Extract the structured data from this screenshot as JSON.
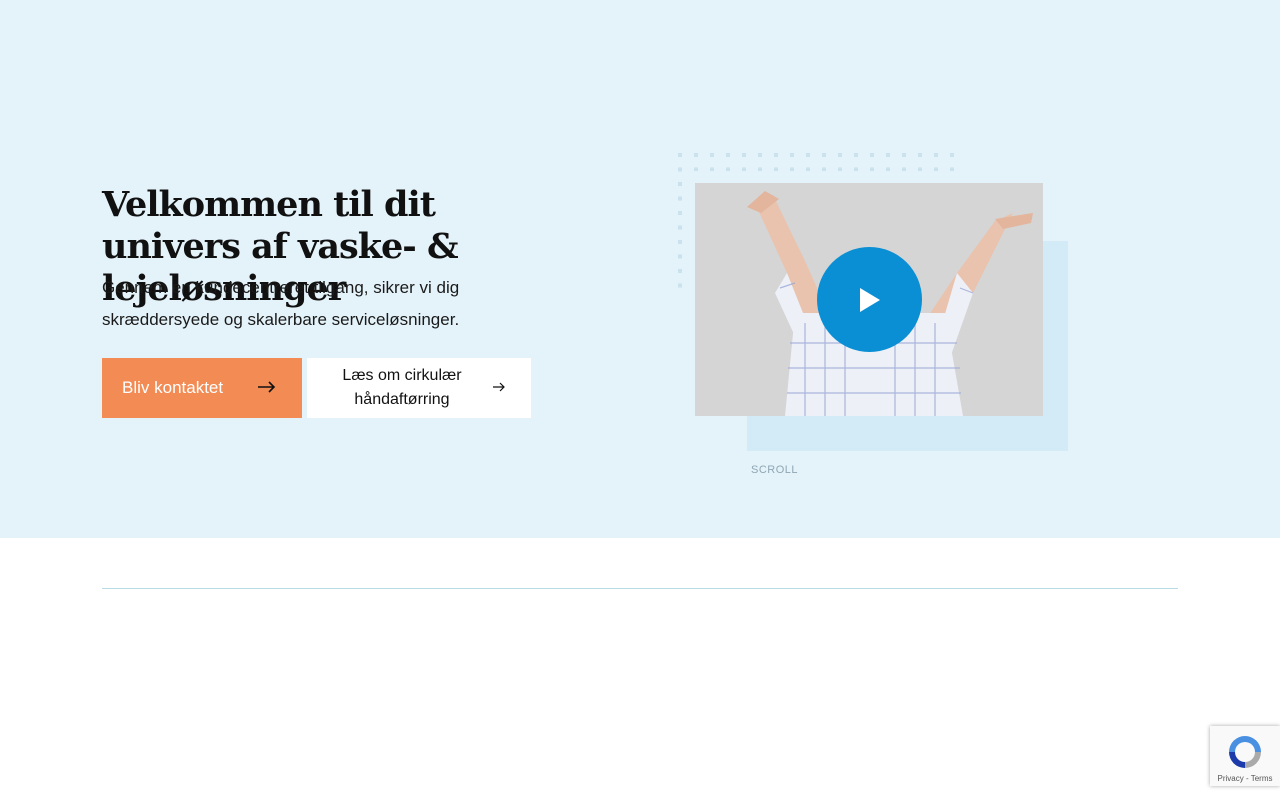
{
  "hero": {
    "title": "Velkommen til dit univers af vaske- & lejeløsninger",
    "subtitle": "Gennem en kundecentreret tilgang, sikrer vi dig skræddersyede og skalerbare serviceløsninger.",
    "primary_button": {
      "label": "Bliv kontaktet",
      "icon": "arrow-right-icon"
    },
    "secondary_button": {
      "label": "Læs om cirkulær håndaftørring",
      "icon": "arrow-right-icon"
    },
    "video": {
      "play_icon": "play-icon"
    },
    "scroll_label": "SCROLL"
  },
  "recaptcha": {
    "text": "Privacy - Terms"
  },
  "colors": {
    "hero_background": "#e4f3fa",
    "accent_box": "#d3ebf6",
    "primary_button": "#f28b54",
    "play_button": "#0a8fd4",
    "divider": "#b9dbe6"
  }
}
